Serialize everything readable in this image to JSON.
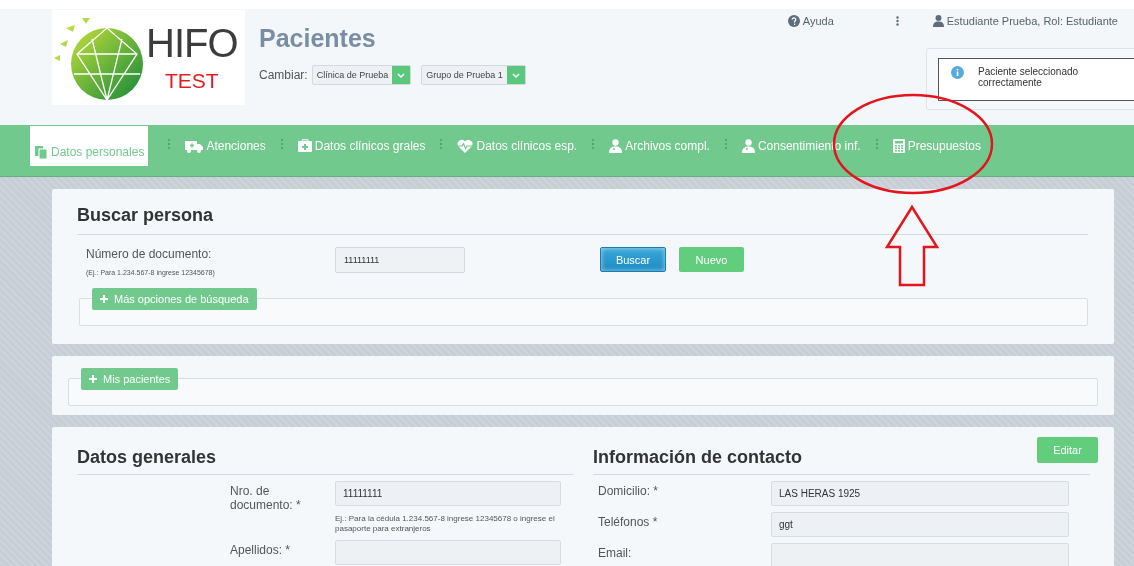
{
  "logo": {
    "word": "HIFO",
    "tag": "TEST"
  },
  "header": {
    "title": "Pacientes",
    "switch_label": "Cambiar:",
    "selects": [
      {
        "value": "Clínica de Prueba"
      },
      {
        "value": "Grupo de Prueba 1"
      }
    ],
    "help": "Ayuda",
    "user": "Estudiante Prueba, Rol: Estudiante"
  },
  "toast": {
    "message": "Paciente seleccionado correctamente"
  },
  "tabs": [
    {
      "label": "Datos personales",
      "selected": true
    },
    {
      "label": "Atenciones",
      "selected": false
    },
    {
      "label": "Datos clínicos grales",
      "selected": false
    },
    {
      "label": "Datos clínicos esp.",
      "selected": false
    },
    {
      "label": "Archivos compl.",
      "selected": false
    },
    {
      "label": "Consentimiento inf.",
      "selected": false
    },
    {
      "label": "Presupuestos",
      "selected": false
    }
  ],
  "search": {
    "title": "Buscar persona",
    "field_label": "Número de documento:",
    "hint": "(Ej.: Para 1.234.567-8 ingrese 12345678)",
    "value": "11111111",
    "buttons": [
      {
        "label": "Buscar",
        "kind": "primary"
      },
      {
        "label": "Nuevo",
        "kind": "success"
      }
    ],
    "more": "Más opciones de búsqueda"
  },
  "my_patients": {
    "label": "Mis pacientes"
  },
  "general": {
    "title": "Datos generales",
    "fields": [
      {
        "label": "Nro. de documento: *",
        "value": "11111111",
        "hint": "Ej.: Para la cédula 1.234.567-8 ingrese 12345678 o ingrese el pasaporte para extranjeros"
      },
      {
        "label": "Apellidos: *"
      }
    ]
  },
  "contact": {
    "title": "Información de contacto",
    "edit": "Editar",
    "fields": [
      {
        "label": "Domicilio: *",
        "value": "LAS HERAS 1925"
      },
      {
        "label": "Teléfonos *",
        "value": "ggt"
      },
      {
        "label": "Email:"
      }
    ]
  }
}
